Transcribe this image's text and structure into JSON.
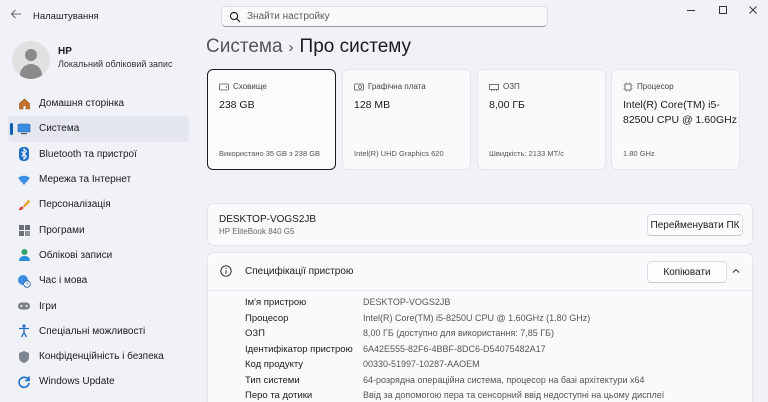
{
  "window": {
    "title": "Налаштування"
  },
  "search": {
    "placeholder": "Знайти настройку"
  },
  "profile": {
    "name": "HP",
    "account_type": "Локальний обліковий запис"
  },
  "sidebar": {
    "items": [
      {
        "label": "Домашня сторінка",
        "icon": "home-icon"
      },
      {
        "label": "Система",
        "icon": "system-icon",
        "active": true
      },
      {
        "label": "Bluetooth та пристрої",
        "icon": "bluetooth-icon"
      },
      {
        "label": "Мережа та Інтернет",
        "icon": "wifi-icon"
      },
      {
        "label": "Персоналізація",
        "icon": "brush-icon"
      },
      {
        "label": "Програми",
        "icon": "apps-icon"
      },
      {
        "label": "Облікові записи",
        "icon": "accounts-icon"
      },
      {
        "label": "Час і мова",
        "icon": "globe-clock-icon"
      },
      {
        "label": "Ігри",
        "icon": "gamepad-icon"
      },
      {
        "label": "Спеціальні можливості",
        "icon": "accessibility-icon"
      },
      {
        "label": "Конфіденційність і безпека",
        "icon": "shield-icon"
      },
      {
        "label": "Windows Update",
        "icon": "update-icon"
      }
    ]
  },
  "breadcrumb": {
    "parent": "Система",
    "separator": "›",
    "current": "Про систему"
  },
  "cards": [
    {
      "label": "Сховище",
      "value": "238 GB",
      "sub": "Використано 35 GB з 238 GB",
      "icon": "storage-icon"
    },
    {
      "label": "Графічна плата",
      "value": "128 MB",
      "sub": "Intel(R) UHD Graphics 620",
      "icon": "gpu-icon"
    },
    {
      "label": "ОЗП",
      "value": "8,00 ГБ",
      "sub": "Швидкість: 2133 MT/c",
      "icon": "ram-icon"
    },
    {
      "label": "Процесор",
      "value": "Intel(R) Core(TM) i5-8250U CPU @ 1.60GHz",
      "sub": "1.80 GHz",
      "icon": "cpu-icon"
    }
  ],
  "device": {
    "name": "DESKTOP-VOGS2JB",
    "model": "HP EliteBook 840 G5",
    "rename_label": "Перейменувати ПК"
  },
  "specs": {
    "title": "Специфікації пристрою",
    "copy_label": "Копіювати",
    "rows": [
      {
        "key": "Ім'я пристрою",
        "value": "DESKTOP-VOGS2JB"
      },
      {
        "key": "Процесор",
        "value": "Intel(R) Core(TM) i5-8250U CPU @ 1.60GHz (1.80 GHz)"
      },
      {
        "key": "ОЗП",
        "value": "8,00 ГБ (доступно для використання: 7,85 ГБ)"
      },
      {
        "key": "Ідентифікатор пристрою",
        "value": "6A42E555-82F6-4BBF-8DC6-D54075482A17"
      },
      {
        "key": "Код продукту",
        "value": "00330-51997-10287-AAOEM"
      },
      {
        "key": "Тип системи",
        "value": "64-розрядна операційна система, процесор на базі архітектури x64"
      },
      {
        "key": "Перо та дотики",
        "value": "Ввід за допомогою пера та сенсорний ввід недоступні на цьому дисплеї"
      }
    ]
  },
  "colors": {
    "accent": "#0a5fb8",
    "background": "#f0f2f8"
  }
}
